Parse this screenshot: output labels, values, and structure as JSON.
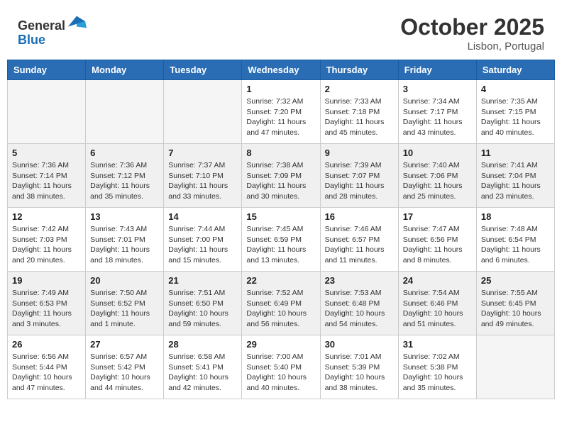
{
  "header": {
    "logo_line1": "General",
    "logo_line2": "Blue",
    "month": "October 2025",
    "location": "Lisbon, Portugal"
  },
  "days_of_week": [
    "Sunday",
    "Monday",
    "Tuesday",
    "Wednesday",
    "Thursday",
    "Friday",
    "Saturday"
  ],
  "weeks": [
    [
      {
        "day": "",
        "info": ""
      },
      {
        "day": "",
        "info": ""
      },
      {
        "day": "",
        "info": ""
      },
      {
        "day": "1",
        "info": "Sunrise: 7:32 AM\nSunset: 7:20 PM\nDaylight: 11 hours\nand 47 minutes."
      },
      {
        "day": "2",
        "info": "Sunrise: 7:33 AM\nSunset: 7:18 PM\nDaylight: 11 hours\nand 45 minutes."
      },
      {
        "day": "3",
        "info": "Sunrise: 7:34 AM\nSunset: 7:17 PM\nDaylight: 11 hours\nand 43 minutes."
      },
      {
        "day": "4",
        "info": "Sunrise: 7:35 AM\nSunset: 7:15 PM\nDaylight: 11 hours\nand 40 minutes."
      }
    ],
    [
      {
        "day": "5",
        "info": "Sunrise: 7:36 AM\nSunset: 7:14 PM\nDaylight: 11 hours\nand 38 minutes."
      },
      {
        "day": "6",
        "info": "Sunrise: 7:36 AM\nSunset: 7:12 PM\nDaylight: 11 hours\nand 35 minutes."
      },
      {
        "day": "7",
        "info": "Sunrise: 7:37 AM\nSunset: 7:10 PM\nDaylight: 11 hours\nand 33 minutes."
      },
      {
        "day": "8",
        "info": "Sunrise: 7:38 AM\nSunset: 7:09 PM\nDaylight: 11 hours\nand 30 minutes."
      },
      {
        "day": "9",
        "info": "Sunrise: 7:39 AM\nSunset: 7:07 PM\nDaylight: 11 hours\nand 28 minutes."
      },
      {
        "day": "10",
        "info": "Sunrise: 7:40 AM\nSunset: 7:06 PM\nDaylight: 11 hours\nand 25 minutes."
      },
      {
        "day": "11",
        "info": "Sunrise: 7:41 AM\nSunset: 7:04 PM\nDaylight: 11 hours\nand 23 minutes."
      }
    ],
    [
      {
        "day": "12",
        "info": "Sunrise: 7:42 AM\nSunset: 7:03 PM\nDaylight: 11 hours\nand 20 minutes."
      },
      {
        "day": "13",
        "info": "Sunrise: 7:43 AM\nSunset: 7:01 PM\nDaylight: 11 hours\nand 18 minutes."
      },
      {
        "day": "14",
        "info": "Sunrise: 7:44 AM\nSunset: 7:00 PM\nDaylight: 11 hours\nand 15 minutes."
      },
      {
        "day": "15",
        "info": "Sunrise: 7:45 AM\nSunset: 6:59 PM\nDaylight: 11 hours\nand 13 minutes."
      },
      {
        "day": "16",
        "info": "Sunrise: 7:46 AM\nSunset: 6:57 PM\nDaylight: 11 hours\nand 11 minutes."
      },
      {
        "day": "17",
        "info": "Sunrise: 7:47 AM\nSunset: 6:56 PM\nDaylight: 11 hours\nand 8 minutes."
      },
      {
        "day": "18",
        "info": "Sunrise: 7:48 AM\nSunset: 6:54 PM\nDaylight: 11 hours\nand 6 minutes."
      }
    ],
    [
      {
        "day": "19",
        "info": "Sunrise: 7:49 AM\nSunset: 6:53 PM\nDaylight: 11 hours\nand 3 minutes."
      },
      {
        "day": "20",
        "info": "Sunrise: 7:50 AM\nSunset: 6:52 PM\nDaylight: 11 hours\nand 1 minute."
      },
      {
        "day": "21",
        "info": "Sunrise: 7:51 AM\nSunset: 6:50 PM\nDaylight: 10 hours\nand 59 minutes."
      },
      {
        "day": "22",
        "info": "Sunrise: 7:52 AM\nSunset: 6:49 PM\nDaylight: 10 hours\nand 56 minutes."
      },
      {
        "day": "23",
        "info": "Sunrise: 7:53 AM\nSunset: 6:48 PM\nDaylight: 10 hours\nand 54 minutes."
      },
      {
        "day": "24",
        "info": "Sunrise: 7:54 AM\nSunset: 6:46 PM\nDaylight: 10 hours\nand 51 minutes."
      },
      {
        "day": "25",
        "info": "Sunrise: 7:55 AM\nSunset: 6:45 PM\nDaylight: 10 hours\nand 49 minutes."
      }
    ],
    [
      {
        "day": "26",
        "info": "Sunrise: 6:56 AM\nSunset: 5:44 PM\nDaylight: 10 hours\nand 47 minutes."
      },
      {
        "day": "27",
        "info": "Sunrise: 6:57 AM\nSunset: 5:42 PM\nDaylight: 10 hours\nand 44 minutes."
      },
      {
        "day": "28",
        "info": "Sunrise: 6:58 AM\nSunset: 5:41 PM\nDaylight: 10 hours\nand 42 minutes."
      },
      {
        "day": "29",
        "info": "Sunrise: 7:00 AM\nSunset: 5:40 PM\nDaylight: 10 hours\nand 40 minutes."
      },
      {
        "day": "30",
        "info": "Sunrise: 7:01 AM\nSunset: 5:39 PM\nDaylight: 10 hours\nand 38 minutes."
      },
      {
        "day": "31",
        "info": "Sunrise: 7:02 AM\nSunset: 5:38 PM\nDaylight: 10 hours\nand 35 minutes."
      },
      {
        "day": "",
        "info": ""
      }
    ]
  ]
}
